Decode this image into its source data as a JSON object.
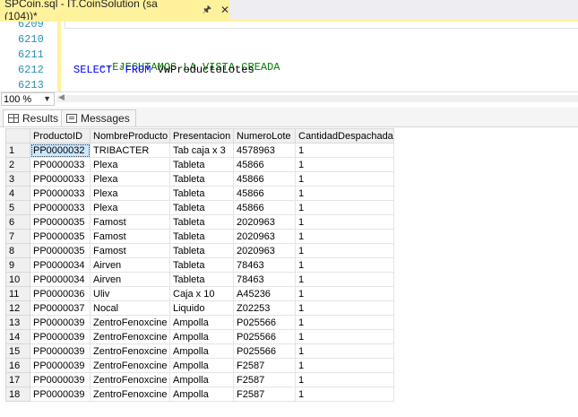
{
  "tab": {
    "title": "SPCoin.sql - IT.CoinSolution (sa (104))*",
    "pin_icon": "pin-icon",
    "close_icon": "close-icon"
  },
  "editor": {
    "lines": [
      {
        "number": "6209",
        "text": ""
      },
      {
        "number": "6210",
        "text": ""
      },
      {
        "number": "6211",
        "comment": "--EJECUTAMOS LA VISTA CREADA"
      },
      {
        "number": "6212",
        "keyword1": "SELECT",
        "op": " *",
        "keyword2": "FROM",
        "ident": " VwProductoLotes"
      },
      {
        "number": "6213",
        "text": ""
      }
    ]
  },
  "zoom": {
    "value": "100 %"
  },
  "result_tabs": [
    {
      "label": "Results",
      "icon": "grid-icon",
      "active": true
    },
    {
      "label": "Messages",
      "icon": "messages-icon",
      "active": false
    }
  ],
  "grid": {
    "columns": [
      "ProductoID",
      "NombreProducto",
      "Presentacion",
      "NumeroLote",
      "CantidadDespachada"
    ],
    "rows": [
      [
        "1",
        "PP0000032",
        "TRIBACTER",
        "Tab caja x 3",
        "4578963",
        "1"
      ],
      [
        "2",
        "PP0000033",
        "Plexa",
        "Tableta",
        "45866",
        "1"
      ],
      [
        "3",
        "PP0000033",
        "Plexa",
        "Tableta",
        "45866",
        "1"
      ],
      [
        "4",
        "PP0000033",
        "Plexa",
        "Tableta",
        "45866",
        "1"
      ],
      [
        "5",
        "PP0000033",
        "Plexa",
        "Tableta",
        "45866",
        "1"
      ],
      [
        "6",
        "PP0000035",
        "Famost",
        "Tableta",
        "2020963",
        "1"
      ],
      [
        "7",
        "PP0000035",
        "Famost",
        "Tableta",
        "2020963",
        "1"
      ],
      [
        "8",
        "PP0000035",
        "Famost",
        "Tableta",
        "2020963",
        "1"
      ],
      [
        "9",
        "PP0000034",
        "Airven",
        "Tableta",
        "78463",
        "1"
      ],
      [
        "10",
        "PP0000034",
        "Airven",
        "Tableta",
        "78463",
        "1"
      ],
      [
        "11",
        "PP0000036",
        "Uliv",
        "Caja x 10",
        "A45236",
        "1"
      ],
      [
        "12",
        "PP0000037",
        "Nocal",
        "Liquido",
        "Z02253",
        "1"
      ],
      [
        "13",
        "PP0000039",
        "ZentroFenoxcine",
        "Ampolla",
        "P025566",
        "1"
      ],
      [
        "14",
        "PP0000039",
        "ZentroFenoxcine",
        "Ampolla",
        "P025566",
        "1"
      ],
      [
        "15",
        "PP0000039",
        "ZentroFenoxcine",
        "Ampolla",
        "P025566",
        "1"
      ],
      [
        "16",
        "PP0000039",
        "ZentroFenoxcine",
        "Ampolla",
        "F2587",
        "1"
      ],
      [
        "17",
        "PP0000039",
        "ZentroFenoxcine",
        "Ampolla",
        "F2587",
        "1"
      ],
      [
        "18",
        "PP0000039",
        "ZentroFenoxcine",
        "Ampolla",
        "F2587",
        "1"
      ]
    ]
  },
  "colors": {
    "tab_active": "#fff29d",
    "comment": "#008000",
    "keyword": "#0000ff",
    "line_number": "#2b91af",
    "selection": "#cce8ff"
  }
}
